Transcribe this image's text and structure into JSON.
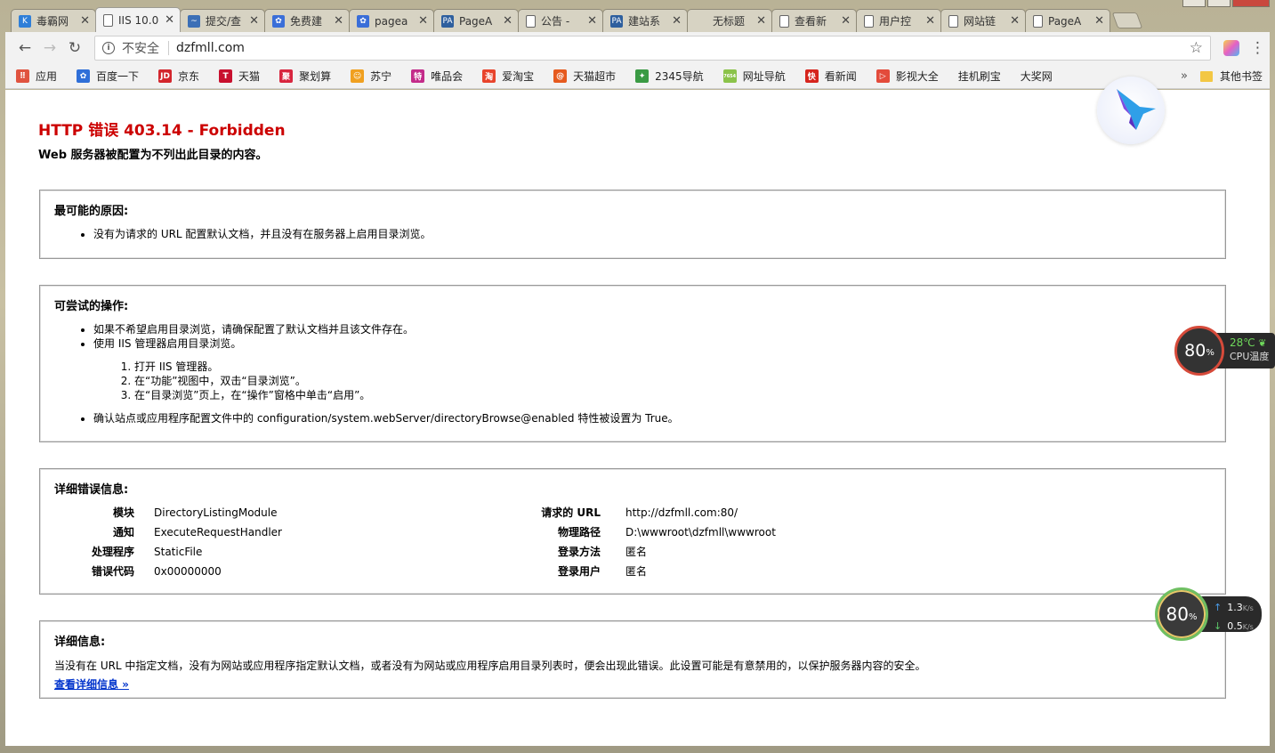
{
  "tabs": [
    {
      "label": "毒霸网",
      "icon": "k-icon",
      "color": "#2f7fd8",
      "glyph": "K"
    },
    {
      "label": "IIS 10.0",
      "icon": "page-icon",
      "active": true
    },
    {
      "label": "提交/查",
      "icon": "wave-icon",
      "color": "#3b6fb6",
      "glyph": "~"
    },
    {
      "label": "免费建",
      "icon": "paw-icon",
      "color": "#3a6ed8",
      "glyph": "✿"
    },
    {
      "label": "pagea",
      "icon": "paw-icon",
      "color": "#3a6ed8",
      "glyph": "✿"
    },
    {
      "label": "PageA",
      "icon": "pa-icon",
      "color": "#2e5f9e",
      "glyph": "PA"
    },
    {
      "label": "公告 -",
      "icon": "page-icon"
    },
    {
      "label": "建站系",
      "icon": "pa-icon",
      "color": "#2e5f9e",
      "glyph": "PA"
    },
    {
      "label": "无标题",
      "icon": "blank-icon"
    },
    {
      "label": "查看新",
      "icon": "page-icon"
    },
    {
      "label": "用户控",
      "icon": "page-icon"
    },
    {
      "label": "网站链",
      "icon": "page-icon"
    },
    {
      "label": "PageA",
      "icon": "page-icon"
    }
  ],
  "toolbar": {
    "security_label": "不安全",
    "url": "dzfmll.com"
  },
  "bookmarks": [
    {
      "label": "应用",
      "icon": "apps-icon",
      "color": "#e0533f",
      "glyph": "⠿"
    },
    {
      "label": "百度一下",
      "icon": "baidu-icon",
      "color": "#2f6fd8",
      "glyph": "✿"
    },
    {
      "label": "京东",
      "icon": "jd-icon",
      "color": "#d3262d",
      "glyph": "JD"
    },
    {
      "label": "天猫",
      "icon": "tmall-icon",
      "color": "#c8102e",
      "glyph": "T"
    },
    {
      "label": "聚划算",
      "icon": "juhuasuan-icon",
      "color": "#d8263f",
      "glyph": "聚"
    },
    {
      "label": "苏宁",
      "icon": "suning-icon",
      "color": "#f0a020",
      "glyph": "☺"
    },
    {
      "label": "唯品会",
      "icon": "vip-icon",
      "color": "#c32b8a",
      "glyph": "特"
    },
    {
      "label": "爱淘宝",
      "icon": "taobao-icon",
      "color": "#e8442c",
      "glyph": "淘"
    },
    {
      "label": "天猫超市",
      "icon": "tmall-market-icon",
      "color": "#e65a1e",
      "glyph": "@"
    },
    {
      "label": "2345导航",
      "icon": "2345-icon",
      "color": "#3a9a44",
      "glyph": "✦"
    },
    {
      "label": "网址导航",
      "icon": "7654-icon",
      "color": "#8bc34a",
      "glyph": "7654"
    },
    {
      "label": "看新闻",
      "icon": "news-icon",
      "color": "#d6251d",
      "glyph": "快"
    },
    {
      "label": "影视大全",
      "icon": "video-icon",
      "color": "#e34b3b",
      "glyph": "▷"
    },
    {
      "label": "挂机刷宝",
      "icon": "page-icon"
    },
    {
      "label": "大奖网",
      "icon": "page-icon"
    }
  ],
  "bookmarks_more": "»",
  "other_bookmarks": "其他书签",
  "error": {
    "title": "HTTP 错误 403.14 - Forbidden",
    "subtitle": "Web 服务器被配置为不列出此目录的内容。"
  },
  "causes": {
    "heading": "最可能的原因:",
    "items": [
      "没有为请求的 URL 配置默认文档，并且没有在服务器上启用目录浏览。"
    ]
  },
  "actions": {
    "heading": "可尝试的操作:",
    "items": [
      "如果不希望启用目录浏览，请确保配置了默认文档并且该文件存在。",
      "使用 IIS 管理器启用目录浏览。"
    ],
    "steps": [
      "打开 IIS 管理器。",
      "在“功能”视图中，双击“目录浏览”。",
      "在“目录浏览”页上，在“操作”窗格中单击“启用”。"
    ],
    "last_item": "确认站点或应用程序配置文件中的 configuration/system.webServer/directoryBrowse@enabled 特性被设置为 True。"
  },
  "details": {
    "heading": "详细错误信息:",
    "rows": [
      {
        "k1": "模块",
        "v1": "DirectoryListingModule",
        "k2": "请求的 URL",
        "v2": "http://dzfmll.com:80/"
      },
      {
        "k1": "通知",
        "v1": "ExecuteRequestHandler",
        "k2": "物理路径",
        "v2": "D:\\wwwroot\\dzfmll\\wwwroot"
      },
      {
        "k1": "处理程序",
        "v1": "StaticFile",
        "k2": "登录方法",
        "v2": "匿名"
      },
      {
        "k1": "错误代码",
        "v1": "0x00000000",
        "k2": "登录用户",
        "v2": "匿名"
      }
    ]
  },
  "more_info": {
    "heading": "详细信息:",
    "text": "当没有在 URL 中指定文档，没有为网站或应用程序指定默认文档，或者没有为网站或应用程序启用目录列表时，便会出现此错误。此设置可能是有意禁用的，以保护服务器内容的安全。",
    "link": "查看详细信息 »"
  },
  "widgets": {
    "cpu_percent": "80",
    "cpu_unit": "%",
    "cpu_temp": "28℃",
    "cpu_label": "CPU温度",
    "net_percent": "80",
    "net_unit": "%",
    "upload": "1.3",
    "download": "0.5",
    "rate_unit": "K/s"
  }
}
